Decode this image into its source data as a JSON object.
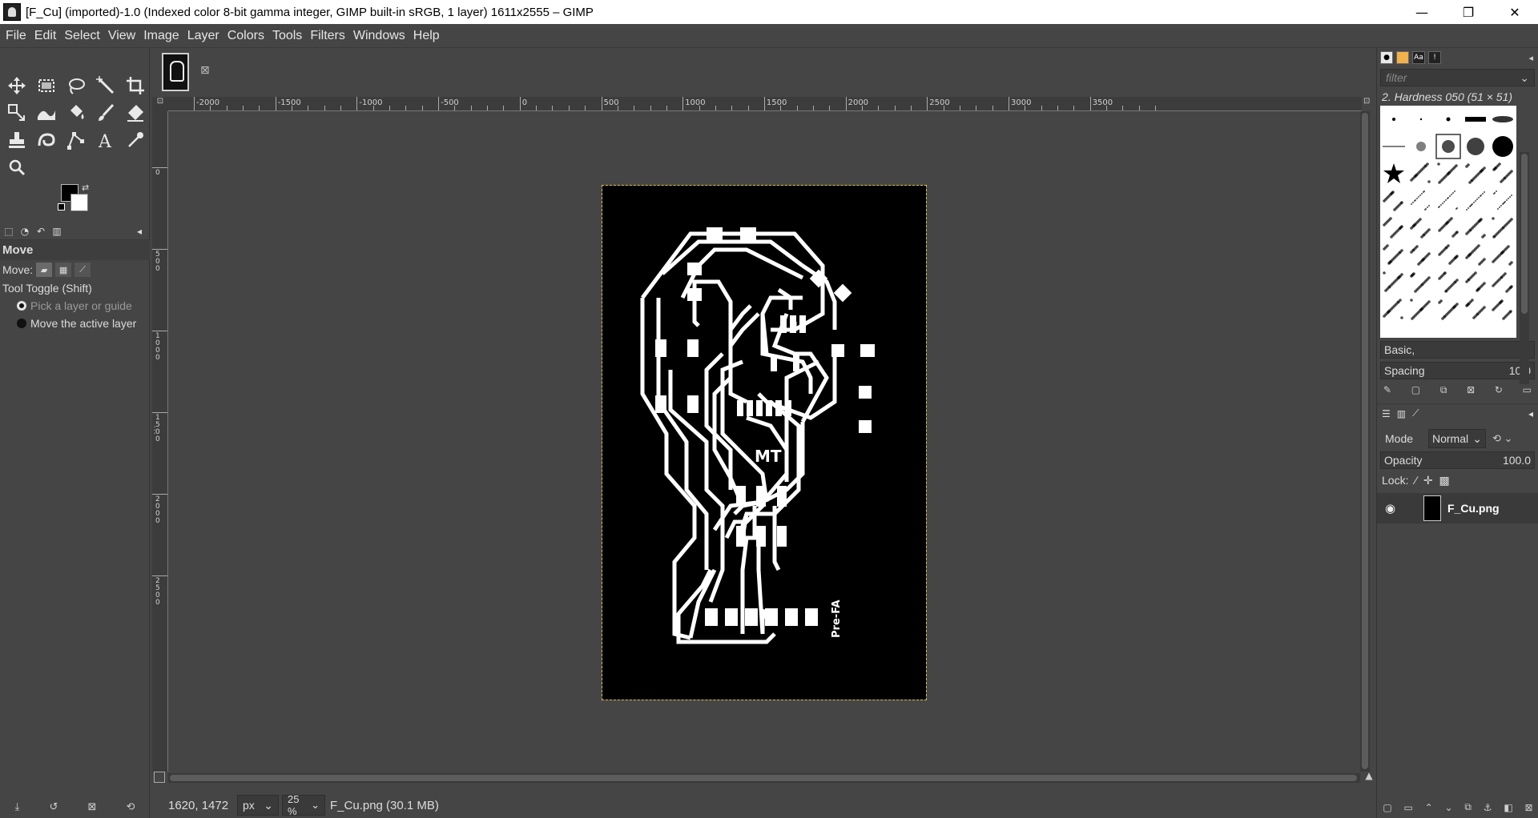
{
  "window": {
    "title": "[F_Cu] (imported)-1.0 (Indexed color 8-bit gamma integer, GIMP built-in sRGB, 1 layer) 1611x2555 – GIMP",
    "minimize": "—",
    "maximize": "❐",
    "close": "✕"
  },
  "menu": [
    "File",
    "Edit",
    "Select",
    "View",
    "Image",
    "Layer",
    "Colors",
    "Tools",
    "Filters",
    "Windows",
    "Help"
  ],
  "toolbox": {
    "tools": [
      [
        "move-tool",
        "rect-select-tool",
        "free-select-tool",
        "fuzzy-select-tool",
        "crop-tool"
      ],
      [
        "unified-transform-tool",
        "warp-transform-tool",
        "bucket-fill-tool",
        "paintbrush-tool",
        "eraser-tool"
      ],
      [
        "clone-tool",
        "smudge-tool",
        "paths-tool",
        "text-tool",
        "color-picker-tool"
      ],
      [
        "zoom-tool"
      ]
    ],
    "fg_color": "#000000",
    "bg_color": "#ffffff"
  },
  "tool_options": {
    "title": "Move",
    "move_label": "Move:",
    "toggle_label": "Tool Toggle  (Shift)",
    "option_pick": "Pick a layer or guide",
    "option_move": "Move the active layer"
  },
  "image_tab": {
    "close": "⊠"
  },
  "rulers": {
    "h_labels": [
      "-2000",
      "-1500",
      "-1000",
      "-500",
      "0",
      "500",
      "1000",
      "1500",
      "2000",
      "2500",
      "3000",
      "3500"
    ],
    "v_labels": [
      "0",
      "500",
      "1000",
      "1500",
      "2000",
      "2500"
    ]
  },
  "status": {
    "coords": "1620, 1472",
    "unit": "px",
    "zoom": "25 %",
    "message": "F_Cu.png (30.1 MB)"
  },
  "pcb": {
    "label_center": "MT",
    "label_side": "Pre-FA"
  },
  "brushes": {
    "filter_placeholder": "filter",
    "current_brush": "2. Hardness 050 (51 × 51)",
    "tag": "Basic,",
    "spacing_label": "Spacing",
    "spacing_value": "10.0"
  },
  "layers": {
    "mode_label": "Mode",
    "mode_value": "Normal",
    "opacity_label": "Opacity",
    "opacity_value": "100.0",
    "lock_label": "Lock:",
    "items": [
      {
        "name": "F_Cu.png"
      }
    ]
  }
}
